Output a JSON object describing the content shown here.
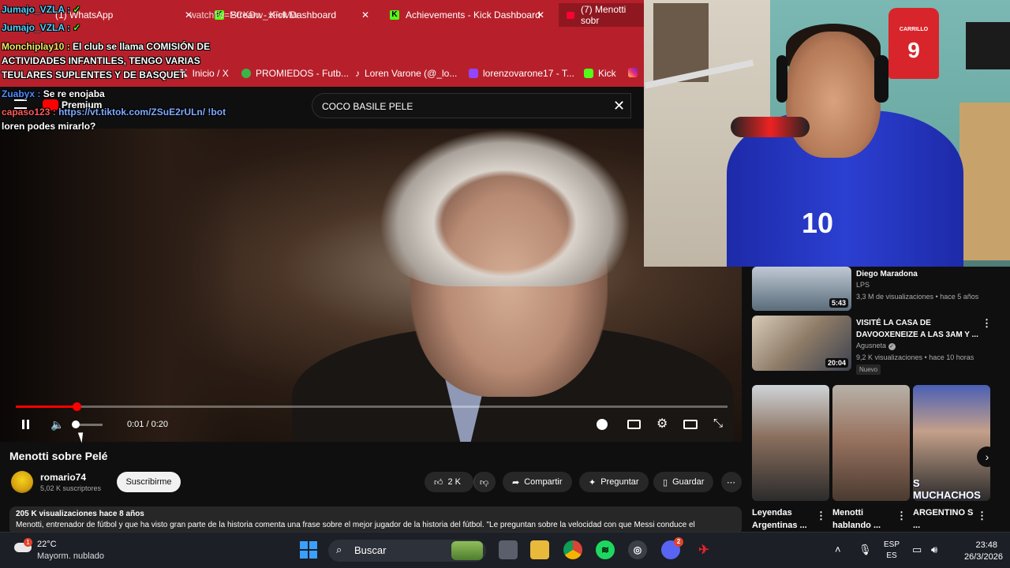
{
  "browser": {
    "tabs": [
      {
        "label": "(1) WhatsApp"
      },
      {
        "label": "Stream - Kick Dashboard"
      },
      {
        "label": "Achievements - Kick Dashboard"
      },
      {
        "label": "(7) Menotti sobr"
      }
    ],
    "address": "watch?v=PCKDw_xFvMw",
    "bookmarks": [
      {
        "label": "Inicio / X"
      },
      {
        "label": "PROMIEDOS - Futb..."
      },
      {
        "label": "Loren Varone (@_lo..."
      },
      {
        "label": "lorenzovarone17 - T..."
      },
      {
        "label": "Kick"
      }
    ]
  },
  "youtube": {
    "premium_label": "Premium",
    "search_value": "COCO BASILE PELE"
  },
  "chat": [
    {
      "user": "Jumajo_VZLA :",
      "msg": ""
    },
    {
      "user": "Jumajo_VZLA :",
      "msg": ""
    },
    {
      "user": "Monchiplay10 :",
      "msg": "El club se llama COMISIÓN DE"
    },
    {
      "user": "",
      "msg": "ACTIVIDADES INFANTILES, TENGO VARIAS"
    },
    {
      "user": "",
      "msg": "TEULARES SUPLENTES Y DE BASQUET"
    },
    {
      "user": "Zuabyx :",
      "msg": "Se re enojaba"
    },
    {
      "user": "capaso123 :",
      "msg": "https://vt.tiktok.com/ZSuE2rULn/ !bot"
    },
    {
      "user": "",
      "msg": "loren podes mirarlo?"
    }
  ],
  "player": {
    "time": "0:01 / 0:20",
    "progress_fraction": 0.085,
    "volume_fraction": 0.05
  },
  "video": {
    "title": "Menotti sobre Pelé",
    "channel": "romario74",
    "subscribers": "5,02 K suscriptores",
    "subscribe_label": "Suscribirme",
    "likes": "2 K",
    "share_label": "Compartir",
    "ask_label": "Preguntar",
    "save_label": "Guardar",
    "views_date": "205 K visualizaciones  hace 8 años",
    "description": "Menotti, entrenador de fútbol y que ha visto gran parte de la historia comenta una frase sobre el mejor jugador de la historia del fútbol. \"Le preguntan sobre la velocidad con que Messi conduce el"
  },
  "recommendations": [
    {
      "title": "Diego Maradona",
      "channel": "LPS",
      "meta": "3,3 M de visualizaciones • hace 5 años",
      "duration": "5:43"
    },
    {
      "title": "VISITÉ LA CASA DE DAVOOXENEIZE A LAS 3AM Y ...",
      "channel": "Agusneta",
      "meta": "9,2 K visualizaciones • hace 10 horas",
      "duration": "20:04",
      "badge": "Nuevo"
    }
  ],
  "shorts": [
    {
      "title": "Leyendas Argentinas ..."
    },
    {
      "title": "Menotti hablando ..."
    },
    {
      "title": "ARGENTINO S ...",
      "overlay": "S MUCHACHOS"
    }
  ],
  "webcam": {
    "jersey_number": "9",
    "jersey_name": "CARRILLO",
    "shirt_number": "10"
  },
  "taskbar": {
    "temperature": "22°C",
    "condition": "Mayorm. nublado",
    "search_label": "Buscar",
    "lang_top": "ESP",
    "lang_bottom": "ES",
    "time": "23:48",
    "date": "26/3/2026",
    "notification_count": "1",
    "discord_badge": "2"
  },
  "colors": {
    "chrome": "#b7202b",
    "yt_red": "#ff0000",
    "kick_green": "#53fc18",
    "bg": "#0f0f0f"
  }
}
